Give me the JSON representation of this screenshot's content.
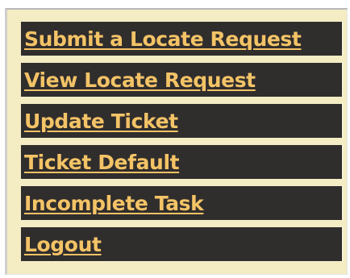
{
  "menu": {
    "items": [
      {
        "label": "Submit a Locate Request"
      },
      {
        "label": "View Locate Request"
      },
      {
        "label": "Update Ticket"
      },
      {
        "label": "Ticket Default"
      },
      {
        "label": "Incomplete Task"
      },
      {
        "label": "Logout"
      }
    ]
  },
  "colors": {
    "panel_bg": "#f4ecc2",
    "item_bg": "#302d2d",
    "link_text": "#f3c366"
  }
}
